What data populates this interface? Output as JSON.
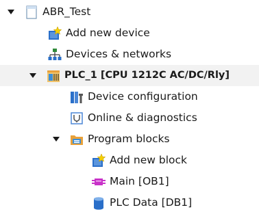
{
  "tree": {
    "project": {
      "label": "ABR_Test",
      "expanded": true,
      "icon": "project-icon"
    },
    "add_new_device": {
      "label": "Add new device",
      "icon": "add-device-icon"
    },
    "devices_networks": {
      "label": "Devices & networks",
      "icon": "network-icon"
    },
    "plc": {
      "label": "PLC_1 [CPU 1212C AC/DC/Rly]",
      "expanded": true,
      "icon": "plc-icon"
    },
    "device_configuration": {
      "label": "Device configuration",
      "icon": "device-config-icon"
    },
    "online_diagnostics": {
      "label": "Online & diagnostics",
      "icon": "diagnostics-icon"
    },
    "program_blocks": {
      "label": "Program blocks",
      "expanded": true,
      "icon": "folder-icon"
    },
    "add_new_block": {
      "label": "Add new block",
      "icon": "add-block-icon"
    },
    "main_ob1": {
      "label": "Main [OB1]",
      "icon": "ob-block-icon"
    },
    "plc_data_db1": {
      "label": "PLC Data [DB1]",
      "icon": "db-block-icon"
    }
  },
  "colors": {
    "selection_bg": "#f2f2f2",
    "accent_blue": "#2a6fc9",
    "folder_orange": "#e8a13a",
    "ob_magenta": "#c832c8"
  }
}
